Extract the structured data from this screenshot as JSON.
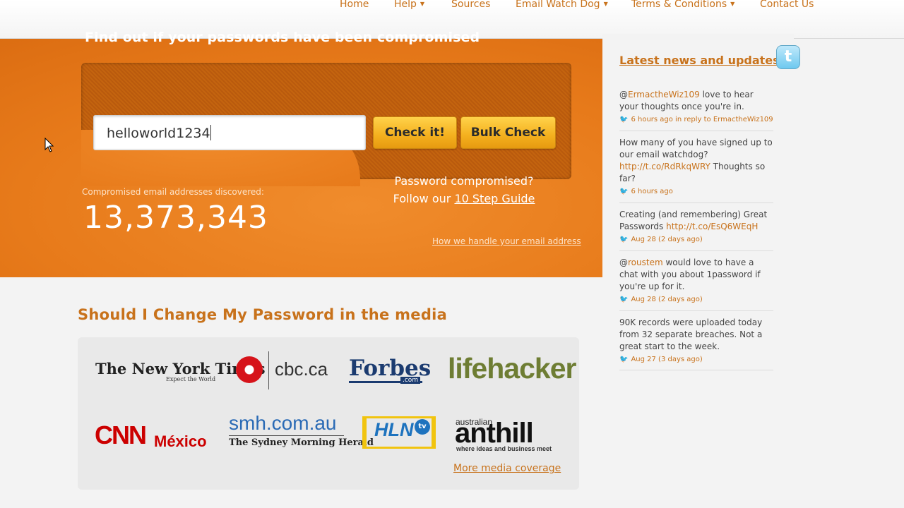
{
  "nav": {
    "items": [
      {
        "label": "Home",
        "dropdown": false
      },
      {
        "label": "Help",
        "dropdown": true
      },
      {
        "label": "Sources",
        "dropdown": false
      },
      {
        "label": "Email Watch Dog",
        "dropdown": true
      },
      {
        "label": "Terms & Conditions",
        "dropdown": true
      },
      {
        "label": "Contact Us",
        "dropdown": false
      }
    ]
  },
  "hero": {
    "title": "Find out if your passwords have been compromised",
    "input_value": "helloworld1234",
    "check_button": "Check it!",
    "bulk_button": "Bulk Check",
    "compromised_question": "Password compromised?",
    "follow_text": "Follow our",
    "guide_link": "10 Step Guide",
    "count_label": "Compromised email addresses discovered:",
    "count": "13,373,343",
    "email_link": "How we handle your email address"
  },
  "sidebar": {
    "title": "Latest news and updates",
    "tweets": [
      {
        "prefix": "@",
        "handle": "ErmactheWiz109",
        "text": " love to hear your thoughts once you're in.",
        "link": "",
        "text_after": "",
        "meta": "6 hours ago in reply to ErmactheWiz109"
      },
      {
        "prefix": "",
        "handle": "",
        "text": "How many of you have signed up to our email watchdog? ",
        "link": "http://t.co/RdRkqWRY",
        "text_after": " Thoughts so far?",
        "meta": "6 hours ago"
      },
      {
        "prefix": "",
        "handle": "",
        "text": "Creating (and remembering) Great Passwords ",
        "link": "http://t.co/EsQ6WEqH",
        "text_after": "",
        "meta": "Aug 28 (2 days ago)"
      },
      {
        "prefix": "@",
        "handle": "roustem",
        "text": " would love to have a chat with you about 1password if you're up for it.",
        "link": "",
        "text_after": "",
        "meta": "Aug 28 (2 days ago)"
      },
      {
        "prefix": "",
        "handle": "",
        "text": "90K records were uploaded today from 32 separate breaches. Not a great start to the week.",
        "link": "",
        "text_after": "",
        "meta": "Aug 27 (3 days ago)"
      }
    ]
  },
  "media": {
    "title": "Should I Change My Password in the media",
    "more_link": "More media coverage",
    "logos": {
      "nyt": "The New York Times",
      "nyt_tag": "Expect the World",
      "cbc": "cbc.ca",
      "forbes": "Forbes",
      "forbes_com": ".com",
      "lifehacker": "lifehacker",
      "cnn": "CNN",
      "cnn_mexico": "México",
      "smh": "smh.com.au",
      "smh_sub": "The Sydney Morning Herald",
      "hln": "HLN",
      "hln_tv": "tv",
      "anthill_small": "australian",
      "anthill": "anthill",
      "anthill_tag": "where ideas and business meet"
    }
  },
  "colors": {
    "accent": "#c8721b",
    "hero_orange": "#e77a1a",
    "button_yellow": "#f4b01e"
  },
  "icons": {
    "twitter": "twitter-bird-icon",
    "nav_caret": "caret-down-icon",
    "tweet_bird": "bird-icon"
  }
}
